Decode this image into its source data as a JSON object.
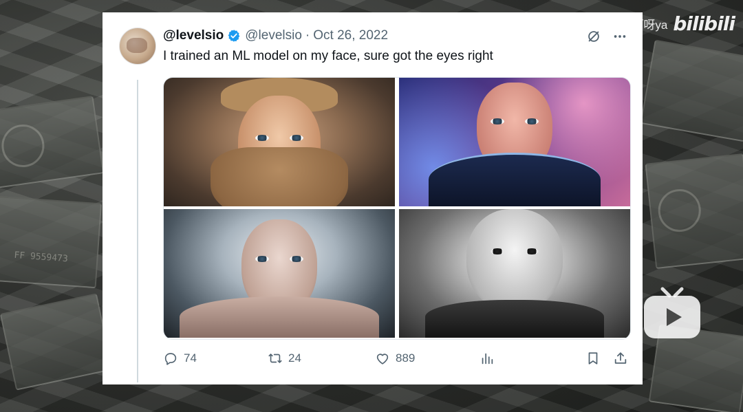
{
  "tweet": {
    "display_name": "@levelsio",
    "handle": "@levelsio",
    "separator": "·",
    "date": "Oct 26, 2022",
    "text": "I trained an ML model on my face, sure got the eyes right",
    "verified": true,
    "images": [
      {
        "alt": "AI portrait with long blond hair and full beard"
      },
      {
        "alt": "AI portrait in space suit against nebula"
      },
      {
        "alt": "AI portrait shirtless with backlight"
      },
      {
        "alt": "AI portrait black and white"
      }
    ],
    "actions": {
      "replies": "74",
      "retweets": "24",
      "likes": "889"
    }
  },
  "overlay": {
    "uploader": "叔叔啊呀ya",
    "platform_logo": "bilibili"
  },
  "colors": {
    "card_bg": "#ffffff",
    "text_primary": "#0f1419",
    "text_secondary": "#536471",
    "verified_blue": "#1d9bf0",
    "thread_line": "#cfd9de"
  },
  "icons": [
    "grok-icon",
    "more-icon",
    "reply-icon",
    "retweet-icon",
    "like-icon",
    "views-icon",
    "bookmark-icon",
    "share-icon",
    "play-icon"
  ]
}
